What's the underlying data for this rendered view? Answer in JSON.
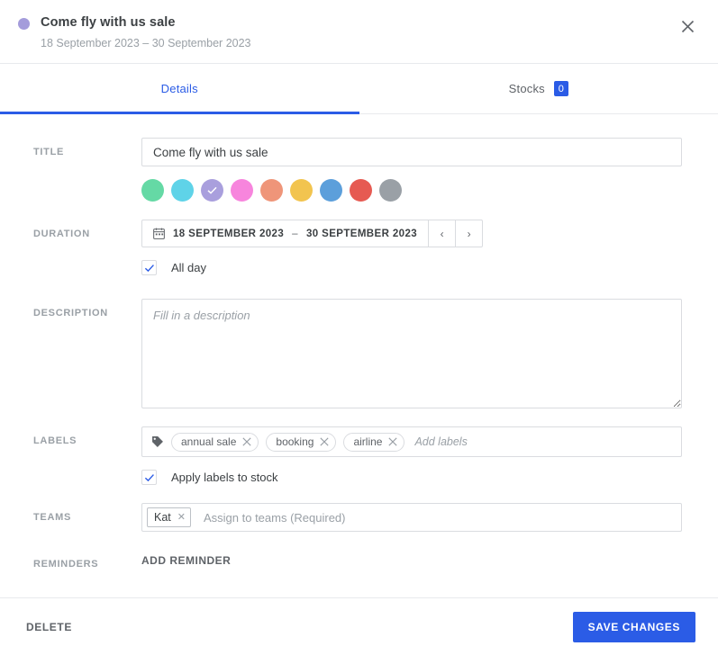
{
  "header": {
    "title": "Come fly with us sale",
    "date_range": "18 September 2023 – 30 September 2023",
    "dot_color": "#a49cdb",
    "close_icon": "close-icon"
  },
  "tabs": [
    {
      "label": "Details",
      "active": true
    },
    {
      "label": "Stocks",
      "active": false,
      "badge": "0"
    }
  ],
  "accent_color": "#2b5ce6",
  "form": {
    "title": {
      "label": "Title",
      "value": "Come fly with us sale"
    },
    "colors": {
      "selected_index": 2,
      "swatches": [
        "#65d9a5",
        "#5fd3e8",
        "#a99fdd",
        "#f785dd",
        "#ef9579",
        "#f2c44f",
        "#5c9fdb",
        "#e65a52",
        "#9aa0a6"
      ]
    },
    "duration": {
      "label": "Duration",
      "start_date": "18 SEPTEMBER 2023",
      "separator": "–",
      "end_date": "30 SEPTEMBER 2023",
      "prev_label": "‹",
      "next_label": "›",
      "calendar_icon": "calendar-icon",
      "all_day": {
        "label": "All day",
        "checked": true
      }
    },
    "description": {
      "label": "Description",
      "value": "",
      "placeholder": "Fill in a description"
    },
    "labels": {
      "label": "Labels",
      "tag_icon": "tag-icon",
      "chips": [
        "annual sale",
        "booking",
        "airline"
      ],
      "placeholder": "Add labels",
      "apply_to_stock": {
        "label": "Apply labels to stock",
        "checked": true
      }
    },
    "teams": {
      "label": "Teams",
      "chips": [
        "Kat"
      ],
      "placeholder": "Assign to teams (Required)"
    },
    "reminders": {
      "label": "Reminders",
      "add_label": "Add reminder"
    }
  },
  "footer": {
    "delete_label": "Delete",
    "save_label": "Save changes"
  }
}
